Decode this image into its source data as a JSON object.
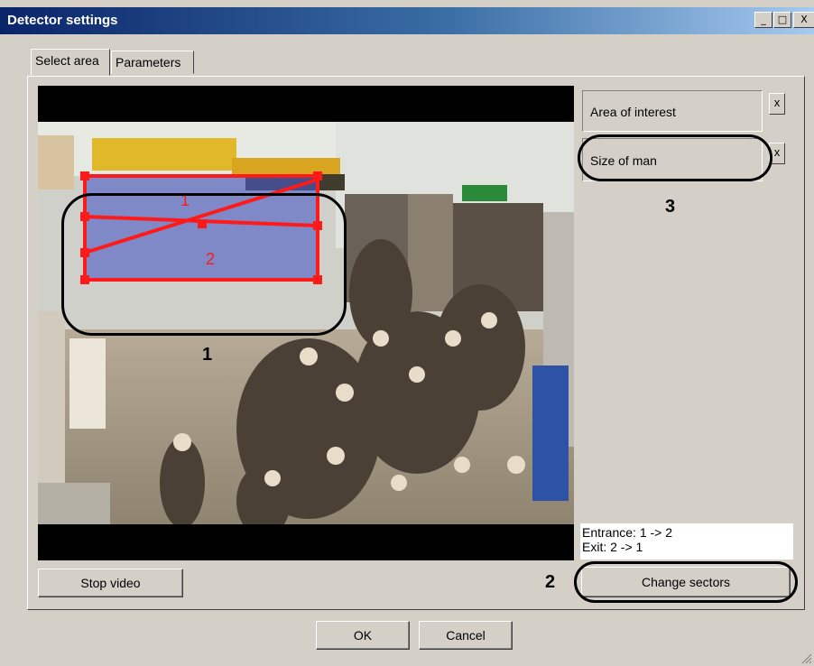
{
  "window": {
    "title": "Detector settings"
  },
  "titlebar_buttons": {
    "minimize": "_",
    "maximize": "□",
    "close": "X"
  },
  "tabs": [
    {
      "label": "Select area",
      "active": true
    },
    {
      "label": "Parameters",
      "active": false
    }
  ],
  "zones": [
    {
      "label": "Area of interest",
      "remove": "x"
    },
    {
      "label": "Size of man",
      "remove": "x"
    }
  ],
  "sector_labels": {
    "first": "1",
    "second": "2"
  },
  "status": {
    "entrance": "Entrance: 1 -> 2",
    "exit": "Exit: 2 -> 1"
  },
  "buttons": {
    "stop_video": "Stop video",
    "change_sectors": "Change sectors",
    "ok": "OK",
    "cancel": "Cancel"
  },
  "annotations": {
    "one": "1",
    "two": "2",
    "three": "3"
  },
  "colors": {
    "title_start": "#0a246a",
    "title_end": "#a6caf0",
    "face": "#d4d0c8",
    "area_line": "#ff1a1a",
    "area_fill": "#4a5ac8"
  }
}
